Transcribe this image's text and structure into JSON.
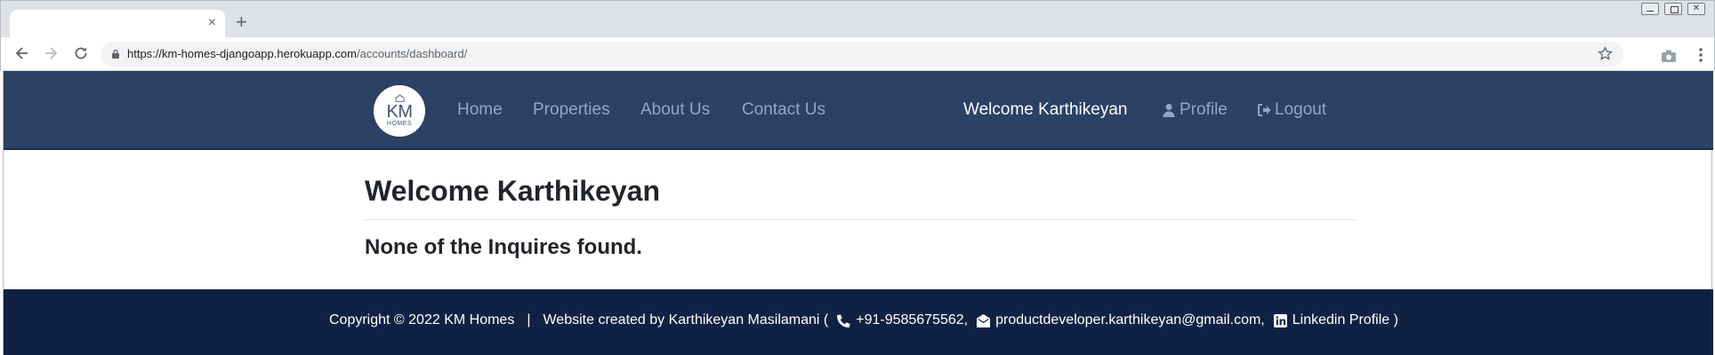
{
  "browser": {
    "tab_close": "×",
    "new_tab": "+",
    "url_domain": "https://km-homes-djangoapp.herokuapp.com",
    "url_path": "/accounts/dashboard/"
  },
  "navbar": {
    "logo_text": "KM",
    "logo_subtext": "HOMES",
    "links": {
      "home": "Home",
      "properties": "Properties",
      "about": "About Us",
      "contact": "Contact Us"
    },
    "welcome": "Welcome Karthikeyan",
    "profile": "Profile",
    "logout": "Logout"
  },
  "main": {
    "title": "Welcome Karthikeyan",
    "message": "None of the Inquires found."
  },
  "footer": {
    "copyright": "Copyright © 2022 KM Homes",
    "separator": "|",
    "created_by": "Website created by Karthikeyan Masilamani (",
    "phone": "+91-9585675562,",
    "email": "productdeveloper.karthikeyan@gmail.com,",
    "linkedin": "Linkedin Profile )"
  },
  "colors": {
    "navbar_bg": "#2c4166",
    "footer_bg": "#0f2244",
    "nav_link": "#93a6c3"
  },
  "icons": [
    "close-icon",
    "plus-icon",
    "back-arrow-icon",
    "forward-arrow-icon",
    "reload-icon",
    "lock-icon",
    "star-icon",
    "camera-icon",
    "menu-dots-icon",
    "house-icon",
    "user-icon",
    "sign-out-icon",
    "phone-icon",
    "envelope-icon",
    "linkedin-icon"
  ]
}
